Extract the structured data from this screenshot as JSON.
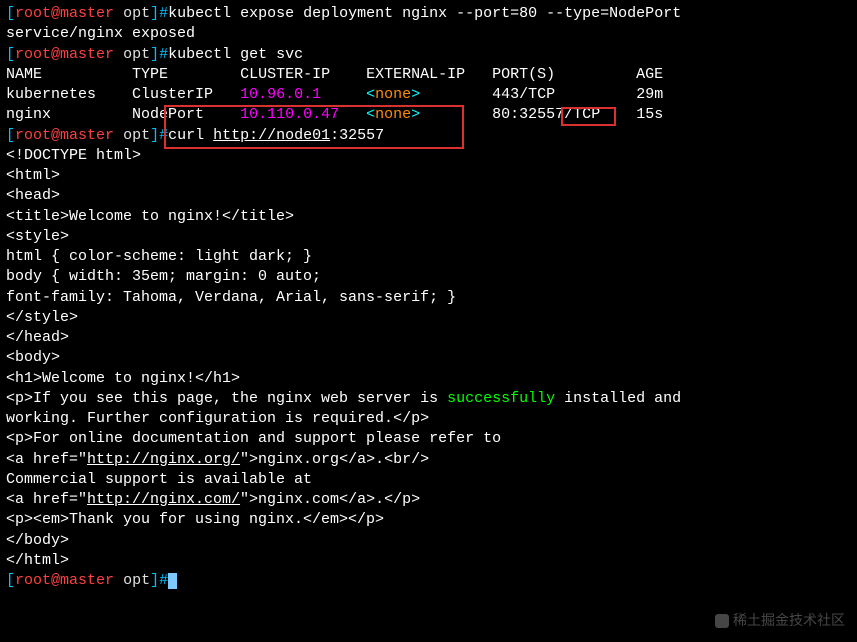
{
  "prompt": {
    "bracket_open": "[",
    "user": "root",
    "at": "@",
    "host": "master",
    "path": " opt",
    "bracket_close": "]",
    "hash": "#"
  },
  "commands": {
    "cmd1": "kubectl expose deployment nginx --port=80 --type=NodePort",
    "out1": "service/nginx exposed",
    "cmd2": "kubectl get svc",
    "cmd3_prefix": "curl ",
    "cmd3_url": "http://node01",
    "cmd3_port": ":32557"
  },
  "svc_table": {
    "headers": {
      "name": "NAME",
      "type": "TYPE",
      "cluster_ip": "CLUSTER-IP",
      "external_ip": "EXTERNAL-IP",
      "ports": "PORT(S)",
      "age": "AGE"
    },
    "rows": [
      {
        "name": "kubernetes",
        "type": "ClusterIP",
        "cluster_ip": "10.96.0.1",
        "external_ip_lt": "<",
        "external_ip_val": "none",
        "external_ip_gt": ">",
        "ports": "443/TCP",
        "age": "29m"
      },
      {
        "name": "nginx",
        "type": "NodePort",
        "cluster_ip": "10.110.0.47",
        "external_ip_lt": "<",
        "external_ip_val": "none",
        "external_ip_gt": ">",
        "ports": "80:32557/TCP",
        "age": "15s"
      }
    ]
  },
  "html_output": {
    "l1": "<!DOCTYPE html>",
    "l2": "<html>",
    "l3": "<head>",
    "l4": "<title>Welcome to nginx!</title>",
    "l5": "<style>",
    "l6": "html { color-scheme: light dark; }",
    "l7": "body { width: 35em; margin: 0 auto;",
    "l8": "font-family: Tahoma, Verdana, Arial, sans-serif; }",
    "l9": "</style>",
    "l10": "</head>",
    "l11": "<body>",
    "l12": "<h1>Welcome to nginx!</h1>",
    "l13a": "<p>If you see this page, the nginx web server is ",
    "l13b": "successfully",
    "l13c": " installed and",
    "l14": "working. Further configuration is required.</p>",
    "l15": "",
    "l16": "<p>For online documentation and support please refer to",
    "l17a": "<a href=\"",
    "l17b": "http://nginx.org/",
    "l17c": "\">nginx.org</a>.<br/>",
    "l18": "Commercial support is available at",
    "l19a": "<a href=\"",
    "l19b": "http://nginx.com/",
    "l19c": "\">nginx.com</a>.</p>",
    "l20": "",
    "l21": "<p><em>Thank you for using nginx.</em></p>",
    "l22": "</body>",
    "l23": "</html>"
  },
  "watermark": "稀土掘金技术社区"
}
